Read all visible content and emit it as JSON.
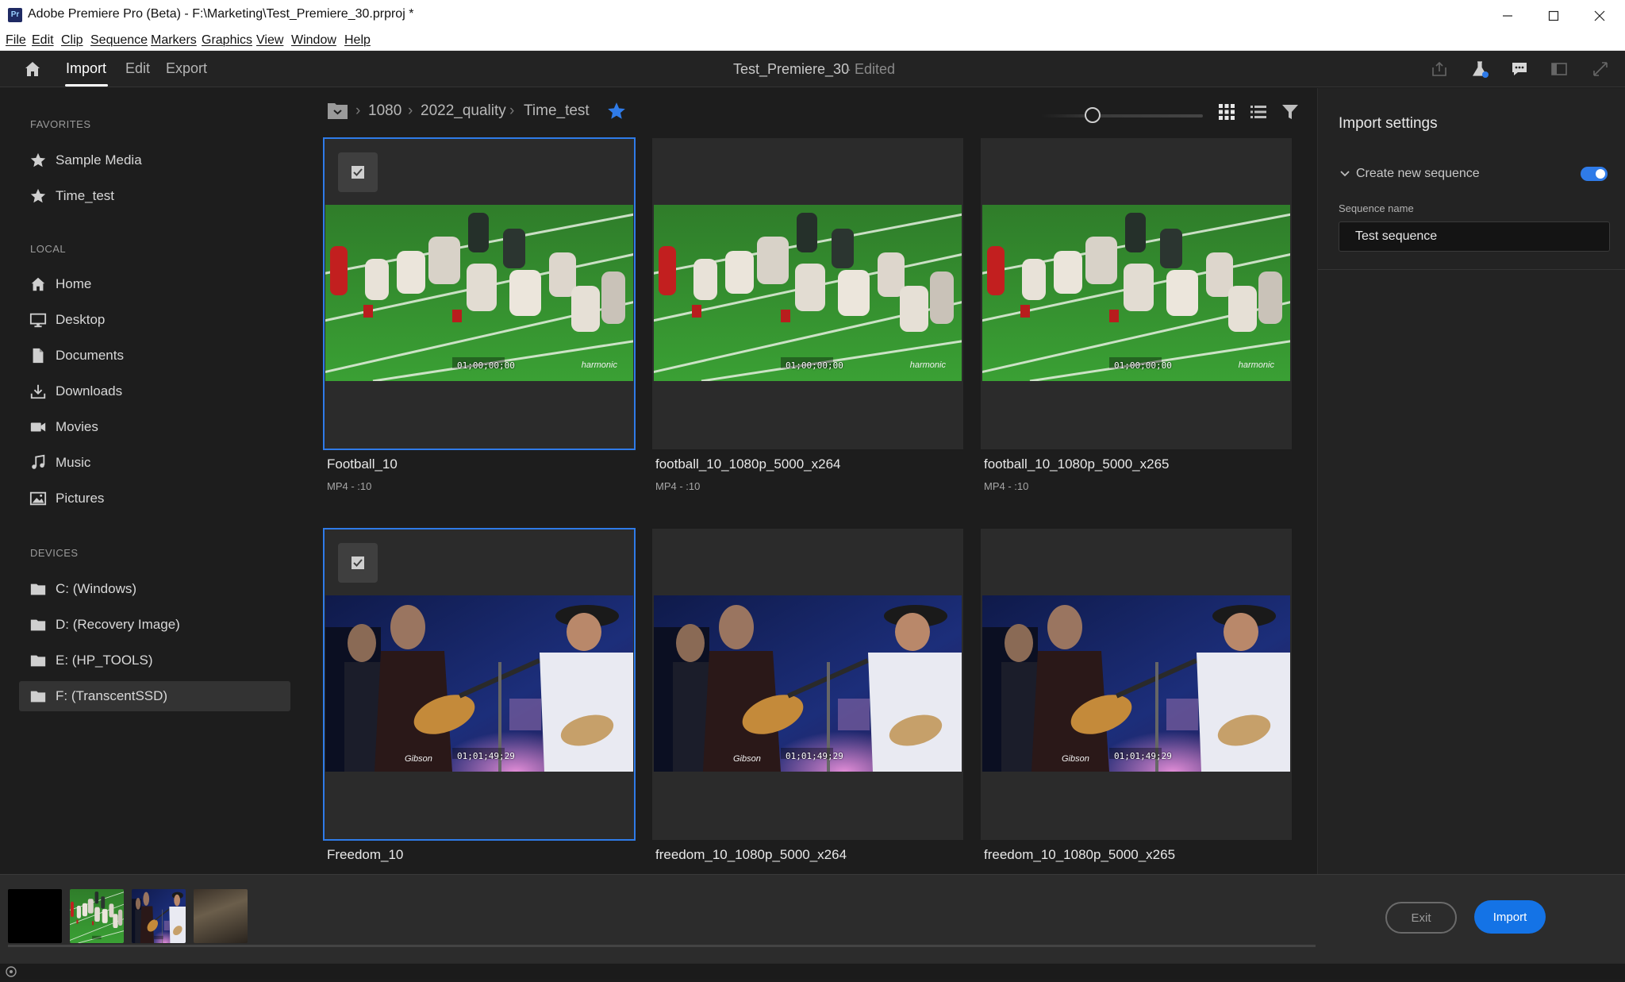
{
  "window": {
    "title": "Adobe Premiere Pro (Beta) - F:\\Marketing\\Test_Premiere_30.prproj *",
    "app_icon": "Pr"
  },
  "menubar": {
    "items": [
      "File",
      "Edit",
      "Clip",
      "Sequence",
      "Markers",
      "Graphics",
      "View",
      "Window",
      "Help"
    ]
  },
  "header": {
    "tabs": [
      {
        "label": "Import",
        "active": true
      },
      {
        "label": "Edit",
        "active": false
      },
      {
        "label": "Export",
        "active": false
      }
    ],
    "project_title": "Test_Premiere_30",
    "project_status": "- Edited"
  },
  "sidebar": {
    "favorites": {
      "heading": "FAVORITES",
      "items": [
        "Sample Media",
        "Time_test"
      ]
    },
    "local": {
      "heading": "LOCAL",
      "items": [
        "Home",
        "Desktop",
        "Documents",
        "Downloads",
        "Movies",
        "Music",
        "Pictures"
      ]
    },
    "devices": {
      "heading": "DEVICES",
      "items": [
        "C: (Windows)",
        "D: (Recovery Image)",
        "E: (HP_TOOLS)",
        "F: (TranscentSSD)"
      ],
      "selected_index": 3
    }
  },
  "browser": {
    "breadcrumb": [
      "1080",
      "2022_quality",
      "Time_test"
    ],
    "zoom_level": 0.3,
    "clips": [
      {
        "title": "Football_10",
        "meta": "MP4 - :10",
        "kind": "football",
        "selected": true,
        "timecode": "01;00;00;00",
        "watermark": "harmonic"
      },
      {
        "title": "football_10_1080p_5000_x264",
        "meta": "MP4 - :10",
        "kind": "football",
        "selected": false,
        "timecode": "01;00;00;00",
        "watermark": "harmonic"
      },
      {
        "title": "football_10_1080p_5000_x265",
        "meta": "MP4 - :10",
        "kind": "football",
        "selected": false,
        "timecode": "01;00;00;00",
        "watermark": "harmonic"
      },
      {
        "title": "Freedom_10",
        "meta": "",
        "kind": "concert",
        "selected": true,
        "timecode": "01;01;49;29",
        "watermark": "Gibson"
      },
      {
        "title": "freedom_10_1080p_5000_x264",
        "meta": "",
        "kind": "concert",
        "selected": false,
        "timecode": "01;01;49;29",
        "watermark": "Gibson"
      },
      {
        "title": "freedom_10_1080p_5000_x265",
        "meta": "",
        "kind": "concert",
        "selected": false,
        "timecode": "01;01;49;29",
        "watermark": "Gibson"
      }
    ]
  },
  "import_settings": {
    "title": "Import settings",
    "create_new_sequence_label": "Create new sequence",
    "create_new_sequence_enabled": true,
    "sequence_name_label": "Sequence name",
    "sequence_name_value": "Test sequence"
  },
  "tray": {
    "exit_label": "Exit",
    "import_label": "Import"
  },
  "colors": {
    "accent": "#1473e6",
    "selection": "#2f7be8",
    "panel": "#232323",
    "background": "#1d1d1d"
  }
}
